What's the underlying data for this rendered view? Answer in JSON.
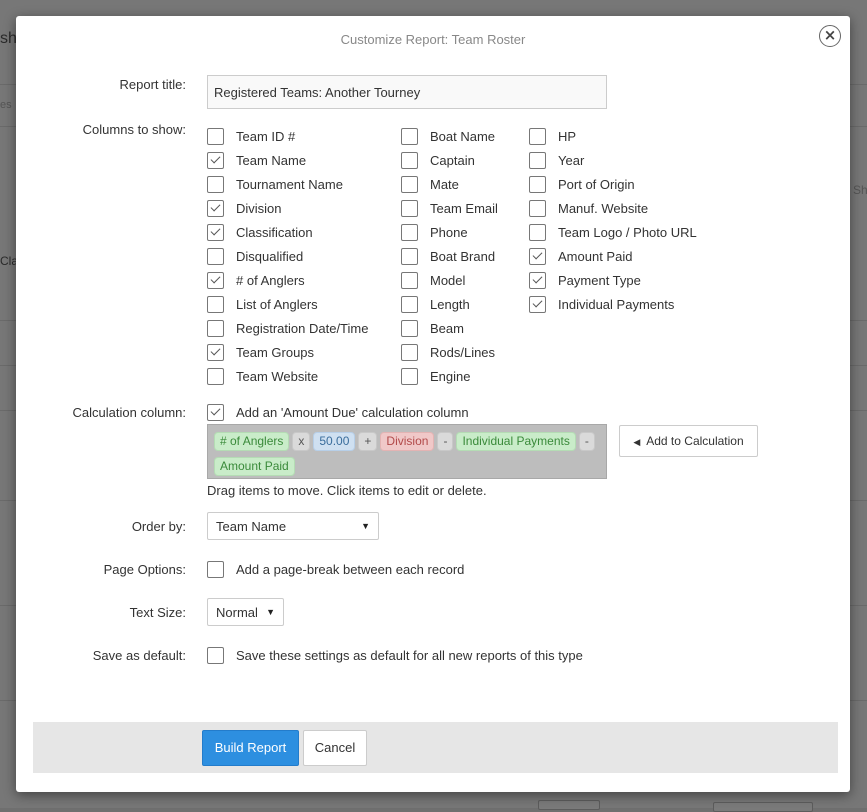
{
  "background": {
    "fragments": [
      "sh",
      "es",
      "Cla",
      "Sh"
    ]
  },
  "modal": {
    "title": "Customize Report: Team Roster",
    "close_glyph": "×"
  },
  "report_title": {
    "label": "Report title:",
    "value": "Registered Teams: Another Tourney"
  },
  "columns": {
    "label": "Columns to show:",
    "col1": [
      {
        "label": "Team ID #",
        "checked": false
      },
      {
        "label": "Team Name",
        "checked": true
      },
      {
        "label": "Tournament Name",
        "checked": false
      },
      {
        "label": "Division",
        "checked": true
      },
      {
        "label": "Classification",
        "checked": true
      },
      {
        "label": "Disqualified",
        "checked": false
      },
      {
        "label": "# of Anglers",
        "checked": true
      },
      {
        "label": "List of Anglers",
        "checked": false
      },
      {
        "label": "Registration Date/Time",
        "checked": false
      },
      {
        "label": "Team Groups",
        "checked": true
      },
      {
        "label": "Team Website",
        "checked": false
      }
    ],
    "col2": [
      {
        "label": "Boat Name",
        "checked": false
      },
      {
        "label": "Captain",
        "checked": false
      },
      {
        "label": "Mate",
        "checked": false
      },
      {
        "label": "Team Email",
        "checked": false
      },
      {
        "label": "Phone",
        "checked": false
      },
      {
        "label": "Boat Brand",
        "checked": false
      },
      {
        "label": "Model",
        "checked": false
      },
      {
        "label": "Length",
        "checked": false
      },
      {
        "label": "Beam",
        "checked": false
      },
      {
        "label": "Rods/Lines",
        "checked": false
      },
      {
        "label": "Engine",
        "checked": false
      }
    ],
    "col3": [
      {
        "label": "HP",
        "checked": false
      },
      {
        "label": "Year",
        "checked": false
      },
      {
        "label": "Port of Origin",
        "checked": false
      },
      {
        "label": "Manuf. Website",
        "checked": false
      },
      {
        "label": "Team Logo / Photo URL",
        "checked": false
      },
      {
        "label": "Amount Paid",
        "checked": true
      },
      {
        "label": "Payment Type",
        "checked": true
      },
      {
        "label": "Individual Payments",
        "checked": true
      }
    ]
  },
  "calculation": {
    "label": "Calculation column:",
    "checkbox_label": "Add an 'Amount Due' calculation column",
    "checked": true,
    "tokens": [
      {
        "text": "# of Anglers",
        "kind": "green"
      },
      {
        "text": "x",
        "kind": "op"
      },
      {
        "text": "50.00",
        "kind": "blue"
      },
      {
        "text": "+",
        "kind": "op"
      },
      {
        "text": "Division",
        "kind": "red"
      },
      {
        "text": "-",
        "kind": "op"
      },
      {
        "text": "Individual Payments",
        "kind": "green"
      },
      {
        "text": "-",
        "kind": "op"
      },
      {
        "text": "Amount Paid",
        "kind": "green"
      }
    ],
    "add_button_label": "Add to Calculation",
    "add_button_icon": "caret-left-icon",
    "hint": "Drag items to move. Click items to edit or delete."
  },
  "order_by": {
    "label": "Order by:",
    "selected": "Team Name"
  },
  "page_options": {
    "label": "Page Options:",
    "checkbox_label": "Add a page-break between each record",
    "checked": false
  },
  "text_size": {
    "label": "Text Size:",
    "selected": "Normal"
  },
  "save_default": {
    "label": "Save as default:",
    "checkbox_label": "Save these settings as default for all new reports of this type",
    "checked": false
  },
  "footer": {
    "build_label": "Build Report",
    "cancel_label": "Cancel"
  },
  "colors": {
    "primary": "#2d8fe0",
    "overlay": "#777777",
    "footer_bg": "#e6e6e6"
  }
}
